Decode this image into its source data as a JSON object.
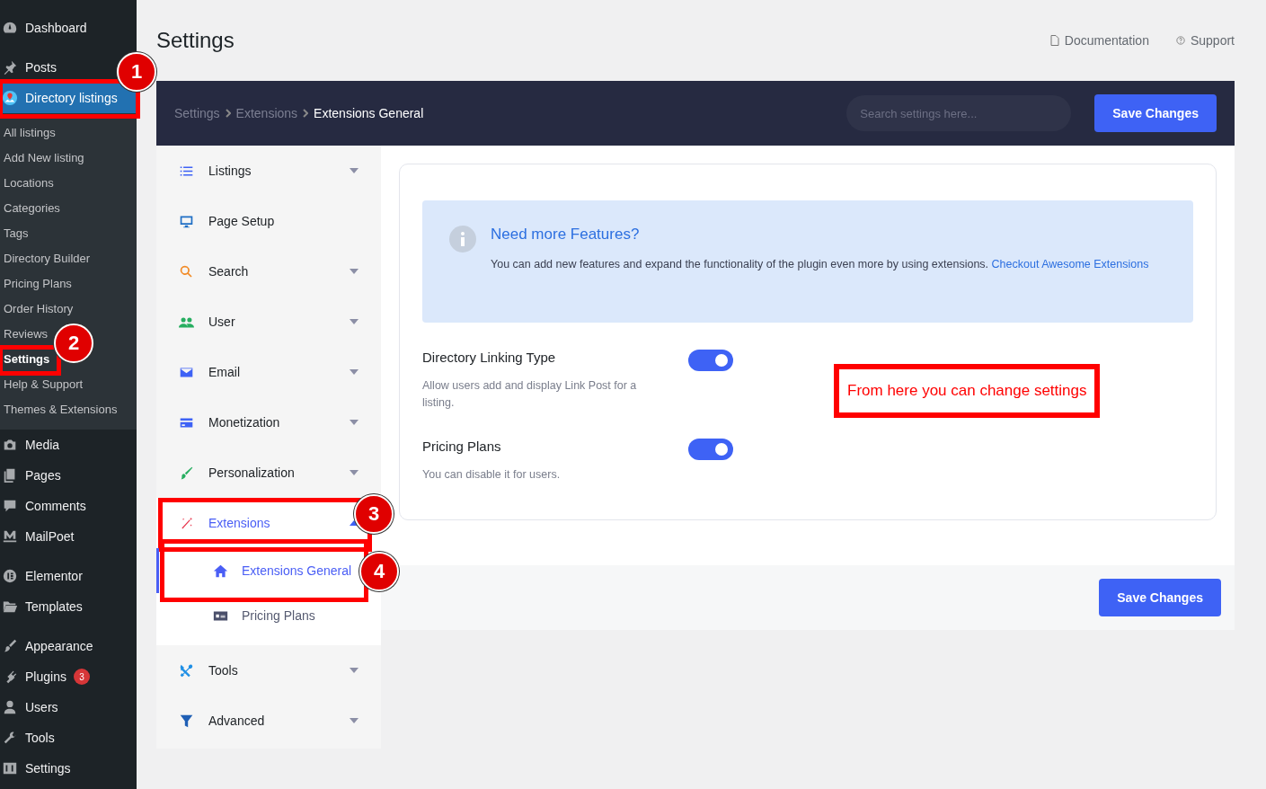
{
  "admin_menu": [
    [
      {
        "label": "Dashboard",
        "selected": false
      }
    ],
    [
      {
        "label": "Posts",
        "selected": false
      },
      {
        "label": "Directory listings",
        "selected": true,
        "annotation": "1",
        "children": [
          {
            "label": "All listings",
            "selected": false
          },
          {
            "label": "Add New listing",
            "selected": false
          },
          {
            "label": "Locations",
            "selected": false
          },
          {
            "label": "Categories",
            "selected": false
          },
          {
            "label": "Tags",
            "selected": false
          },
          {
            "label": "Directory Builder",
            "selected": false
          },
          {
            "label": "Pricing Plans",
            "selected": false
          },
          {
            "label": "Order History",
            "selected": false
          },
          {
            "label": "Reviews",
            "selected": false
          },
          {
            "label": "Settings",
            "selected": true,
            "annotation": "2"
          },
          {
            "label": "Help & Support",
            "selected": false
          },
          {
            "label": "Themes & Extensions",
            "selected": false
          }
        ]
      },
      {
        "label": "Media",
        "selected": false
      },
      {
        "label": "Pages",
        "selected": false
      },
      {
        "label": "Comments",
        "selected": false
      },
      {
        "label": "MailPoet",
        "selected": false
      }
    ],
    [
      {
        "label": "Elementor",
        "selected": false
      },
      {
        "label": "Templates",
        "selected": false
      }
    ],
    [
      {
        "label": "Appearance",
        "selected": false
      },
      {
        "label": "Plugins",
        "selected": false,
        "badge": "3"
      },
      {
        "label": "Users",
        "selected": false
      },
      {
        "label": "Tools",
        "selected": false
      },
      {
        "label": "Settings",
        "selected": false
      }
    ]
  ],
  "page": {
    "title": "Settings",
    "links": [
      "Documentation",
      "Support"
    ]
  },
  "header": {
    "breadcrumb": [
      "Settings",
      "Extensions",
      "Extensions General"
    ],
    "search": {
      "placeholder": "Search settings here..."
    },
    "button": "Save Changes"
  },
  "nav": [
    {
      "label": "Listings",
      "selected": false,
      "expanded": false
    },
    {
      "label": "Page Setup",
      "selected": false
    },
    {
      "label": "Search",
      "selected": false,
      "expanded": false
    },
    {
      "label": "User",
      "selected": false,
      "expanded": false
    },
    {
      "label": "Email",
      "selected": false,
      "expanded": false
    },
    {
      "label": "Monetization",
      "selected": false,
      "expanded": false
    },
    {
      "label": "Personalization",
      "selected": false,
      "expanded": false
    },
    {
      "label": "Extensions",
      "selected": true,
      "expanded": true,
      "annotation": "3",
      "children": [
        {
          "label": "Extensions General",
          "selected": true,
          "annotation": "4"
        },
        {
          "label": "Pricing Plans",
          "selected": false
        }
      ]
    },
    {
      "label": "Tools",
      "selected": false,
      "expanded": false
    },
    {
      "label": "Advanced",
      "selected": false,
      "expanded": false
    }
  ],
  "notice": {
    "title": "Need more Features?",
    "text": "You can add new features and expand the functionality of the plugin even more by using extensions.",
    "link": "Checkout Awesome Extensions"
  },
  "settings": [
    {
      "label": "Directory Linking Type",
      "description": "Allow users add and display Link Post for a listing.",
      "on": true
    },
    {
      "label": "Pricing Plans",
      "description": "You can disable it for users.",
      "on": true
    }
  ],
  "callout": "From here you can change settings",
  "footer": {
    "button": "Save Changes"
  }
}
